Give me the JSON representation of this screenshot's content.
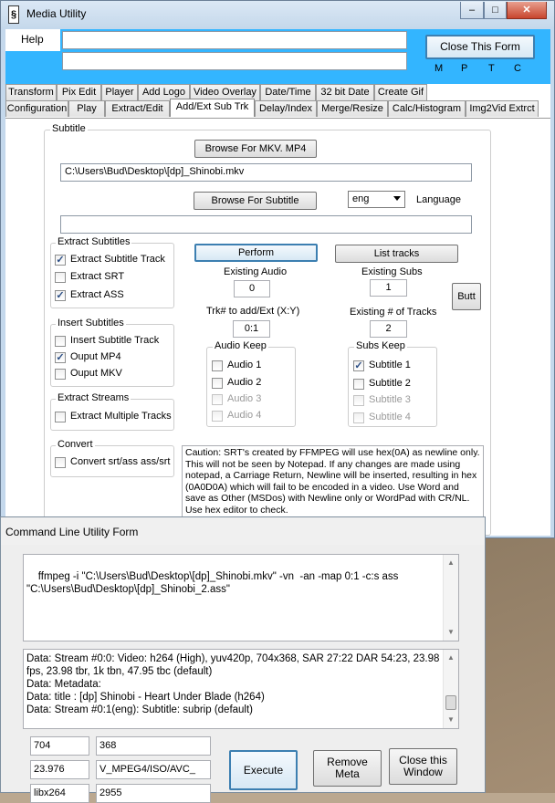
{
  "window": {
    "title": "Media Utility"
  },
  "top": {
    "help": "Help",
    "input1": "",
    "input2": "",
    "close_form": "Close This Form",
    "flags": [
      "M",
      "P",
      "T",
      "C"
    ]
  },
  "tabs_row1": [
    "Transform",
    "Pix Edit",
    "Player",
    "Add Logo",
    "Video Overlay",
    "Date/Time",
    "32 bit Date",
    "Create Gif"
  ],
  "tabs_row2": [
    "Configuration",
    "Play",
    "Extract/Edit",
    "Add/Ext Sub Trk",
    "Delay/Index",
    "Merge/Resize",
    "Calc/Histogram",
    "Img2Vid Extrct"
  ],
  "subtitle": {
    "group_label": "Subtitle",
    "browse_mkv": "Browse For MKV. MP4",
    "file_path": "C:\\Users\\Bud\\Desktop\\[dp]_Shinobi.mkv",
    "browse_sub": "Browse For Subtitle",
    "language_value": "eng",
    "language_label": "Language",
    "sub_path": ""
  },
  "extract_subs": {
    "label": "Extract Subtitles",
    "items": [
      {
        "label": "Extract Subtitle Track",
        "checked": true
      },
      {
        "label": "Extract SRT",
        "checked": false
      },
      {
        "label": "Extract ASS",
        "checked": true
      }
    ]
  },
  "insert_subs": {
    "label": "Insert Subtitles",
    "items": [
      {
        "label": "Insert Subtitle Track",
        "checked": false
      },
      {
        "label": "Ouput MP4",
        "checked": true
      },
      {
        "label": "Ouput MKV",
        "checked": false
      }
    ]
  },
  "extract_streams": {
    "label": "Extract Streams",
    "item": "Extract Multiple Tracks"
  },
  "convert": {
    "label": "Convert",
    "item": "Convert srt/ass ass/srt"
  },
  "actions": {
    "perform": "Perform",
    "list_tracks": "List tracks",
    "butt": "Butt",
    "existing_audio_label": "Existing Audio",
    "existing_audio": "0",
    "existing_subs_label": "Existing Subs",
    "existing_subs": "1",
    "trk_label": "Trk# to add/Ext (X:Y)",
    "trk_value": "0:1",
    "existing_tracks_label": "Existing # of Tracks",
    "existing_tracks": "2"
  },
  "audio_keep": {
    "label": "Audio Keep",
    "items": [
      "Audio 1",
      "Audio 2",
      "Audio 3",
      "Audio 4"
    ]
  },
  "subs_keep": {
    "label": "Subs Keep",
    "items": [
      "Subtitle 1",
      "Subtitle 2",
      "Subtitle 3",
      "Subtitle 4"
    ]
  },
  "caution": "Caution: SRT's created by FFMPEG will use hex(0A) as newline only. This will not be seen by Notepad.  If any changes are made using notepad, a Carriage Return, Newline will be inserted, resulting in hex (0A0D0A) which will fail to be encoded in a video. Use Word and save as Other (MSDos) with Newline only or WordPad with CR/NL. Use hex editor to  check.",
  "cmd": {
    "title": "Command Line Utility Form",
    "command": "ffmpeg -i \"C:\\Users\\Bud\\Desktop\\[dp]_Shinobi.mkv\" -vn  -an -map 0:1 -c:s ass \"C:\\Users\\Bud\\Desktop\\[dp]_Shinobi_2.ass\"",
    "output_lines": [
      "Data:    Stream #0:0: Video: h264 (High), yuv420p, 704x368, SAR 27:22 DAR 54:23, 23.98 fps, 23.98 tbr, 1k tbn, 47.95 tbc (default)",
      "Data:    Metadata:",
      "Data:      title           : [dp] Shinobi - Heart Under Blade (h264)",
      "Data:    Stream #0:1(eng): Subtitle: subrip (default)"
    ],
    "fields": [
      "704",
      "368",
      "23.976",
      "V_MPEG4/ISO/AVC_",
      "libx264",
      "2955"
    ],
    "execute": "Execute",
    "remove_meta": "Remove Meta",
    "close_window": "Close this Window"
  }
}
